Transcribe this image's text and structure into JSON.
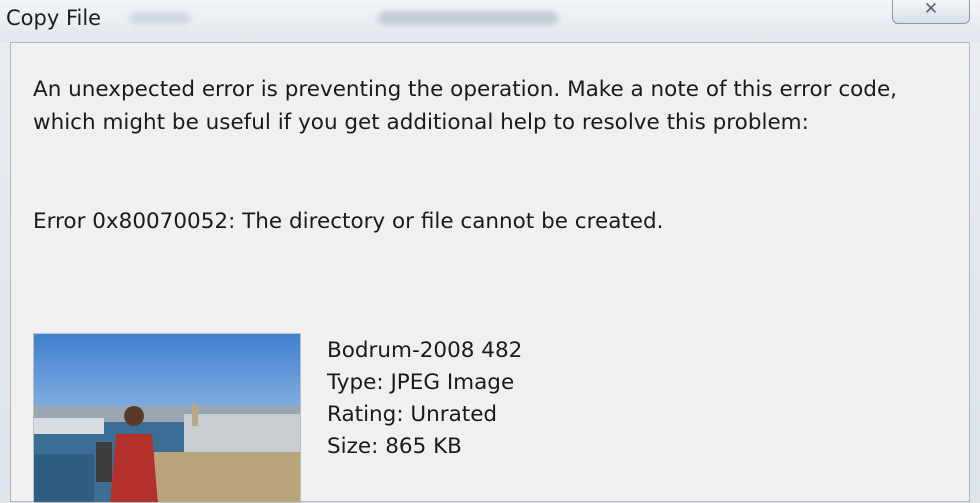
{
  "dialog": {
    "title": "Copy File",
    "close_label": "✕",
    "message": "An unexpected error is preventing the operation. Make a note of this error code, which might be useful if you get additional help to resolve this problem:",
    "error_text": "Error 0x80070052: The directory or file cannot be created."
  },
  "file": {
    "name": "Bodrum-2008 482",
    "type": "Type: JPEG Image",
    "rating": "Rating: Unrated",
    "size": "Size: 865 KB"
  }
}
